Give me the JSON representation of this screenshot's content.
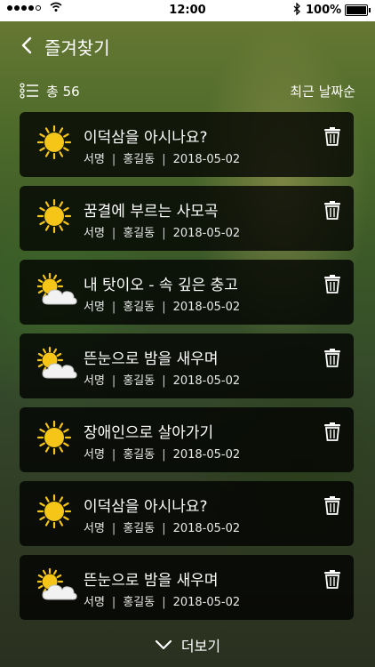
{
  "status_bar": {
    "time": "12:00",
    "battery": "100%"
  },
  "header": {
    "title": "즐겨찾기"
  },
  "summary": {
    "count_label": "총 56",
    "sort_label": "최근 날짜순"
  },
  "items": [
    {
      "title": "이덕삼을 아시나요?",
      "author": "서명",
      "name": "홍길동",
      "date": "2018-05-02",
      "weather": "sun-icon"
    },
    {
      "title": "꿈결에 부르는 사모곡",
      "author": "서명",
      "name": "홍길동",
      "date": "2018-05-02",
      "weather": "sun-icon"
    },
    {
      "title": "내 탓이오 - 속 깊은 충고",
      "author": "서명",
      "name": "홍길동",
      "date": "2018-05-02",
      "weather": "sun-cloud-icon"
    },
    {
      "title": "뜬눈으로 밤을 새우며",
      "author": "서명",
      "name": "홍길동",
      "date": "2018-05-02",
      "weather": "sun-cloud-icon"
    },
    {
      "title": "장애인으로 살아가기",
      "author": "서명",
      "name": "홍길동",
      "date": "2018-05-02",
      "weather": "sun-icon"
    },
    {
      "title": "이덕삼을 아시나요?",
      "author": "서명",
      "name": "홍길동",
      "date": "2018-05-02",
      "weather": "sun-icon"
    },
    {
      "title": "뜬눈으로 밤을 새우며",
      "author": "서명",
      "name": "홍길동",
      "date": "2018-05-02",
      "weather": "sun-cloud-icon"
    }
  ],
  "more_label": "더보기",
  "colors": {
    "sun": "#f5c518",
    "card_bg": "rgba(0,0,0,0.78)"
  }
}
